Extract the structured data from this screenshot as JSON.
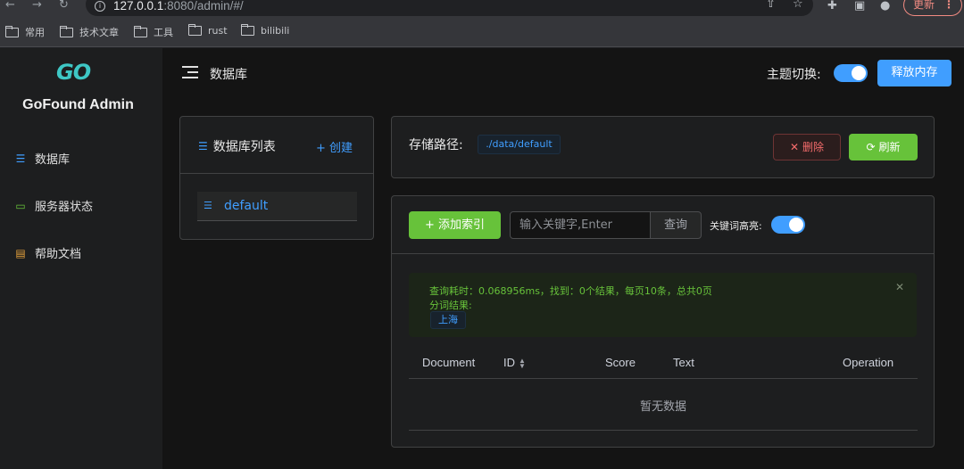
{
  "browser": {
    "url_host": "127.0.0.1",
    "url_rest": ":8080/admin/#/",
    "update_label": "更新",
    "bookmarks": [
      "常用",
      "技术文章",
      "工具",
      "rust",
      "bilibili"
    ]
  },
  "sidebar": {
    "logo_text": "GO",
    "app_name": "GoFound Admin",
    "items": [
      {
        "label": "数据库",
        "icon": "database-icon"
      },
      {
        "label": "服务器状态",
        "icon": "monitor-icon"
      },
      {
        "label": "帮助文档",
        "icon": "document-icon"
      }
    ]
  },
  "header": {
    "title": "数据库",
    "theme_label": "主题切换:",
    "release_label": "释放内存"
  },
  "db_list": {
    "title": "数据库列表",
    "create_label": "+ 创建",
    "items": [
      "default"
    ]
  },
  "storage": {
    "label": "存储路径:",
    "path": "./data/default",
    "delete_label": "删除",
    "refresh_label": "刷新"
  },
  "search": {
    "add_index_label": "添加索引",
    "placeholder": "输入关键字,Enter",
    "query_label": "查询",
    "highlight_label": "关键词高亮:",
    "highlight_on": true
  },
  "result": {
    "summary": "查询耗时：0.068956ms，找到：0个结果，每页10条，总共0页",
    "segment_label": "分词结果:",
    "segments": [
      "上海"
    ]
  },
  "table": {
    "columns": [
      "Document",
      "ID",
      "Score",
      "Text",
      "Operation"
    ],
    "empty_text": "暂无数据"
  },
  "colors": {
    "primary": "#409eff",
    "success": "#67c23a",
    "danger": "#f56c6c",
    "logo": "#3ec7c5"
  }
}
